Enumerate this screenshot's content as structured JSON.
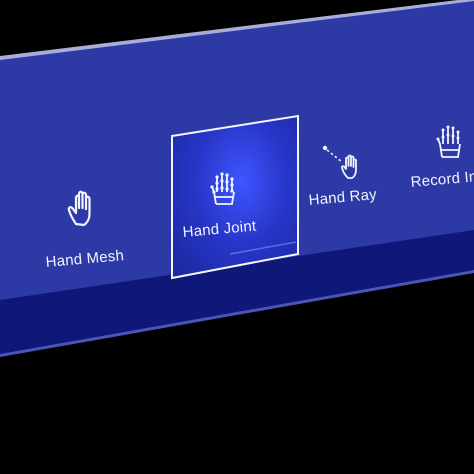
{
  "menu": {
    "buttons": [
      {
        "label": "Hand Mesh",
        "icon": "hand-mesh-icon",
        "selected": false
      },
      {
        "label": "Hand Joint",
        "icon": "hand-joint-icon",
        "selected": true
      },
      {
        "label": "Hand Ray",
        "icon": "hand-ray-icon",
        "selected": false
      },
      {
        "label": "Record Inp",
        "icon": "record-input-icon",
        "selected": false
      }
    ]
  },
  "colors": {
    "panel": "#2d3aa6",
    "panel_shadow": "#0f1878",
    "highlight": "#3f55ff",
    "text": "#f2f4ff"
  }
}
